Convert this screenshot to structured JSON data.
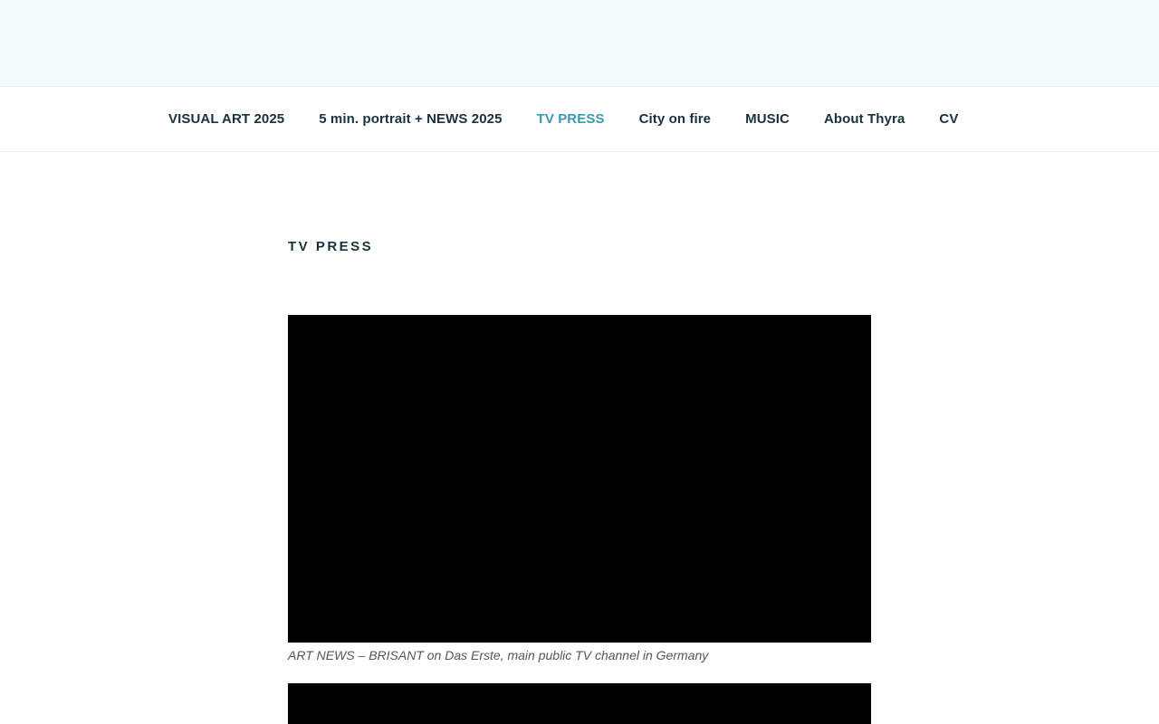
{
  "nav": {
    "items": [
      {
        "label": "VISUAL ART 2025"
      },
      {
        "label": "5 min. portrait + NEWS 2025"
      },
      {
        "label": "TV PRESS",
        "current": true
      },
      {
        "label": "City on fire"
      },
      {
        "label": "MUSIC"
      },
      {
        "label": "About Thyra"
      },
      {
        "label": "CV"
      }
    ]
  },
  "page": {
    "title": "TV PRESS"
  },
  "videos": [
    {
      "caption": "ART NEWS – BRISANT on Das Erste, main public TV channel in Germany"
    },
    {
      "caption": ""
    }
  ],
  "colors": {
    "header_bg": "#f5fcfd",
    "nav_text": "#19323c",
    "nav_active": "#3a9bb0",
    "video_bg": "#000000"
  }
}
